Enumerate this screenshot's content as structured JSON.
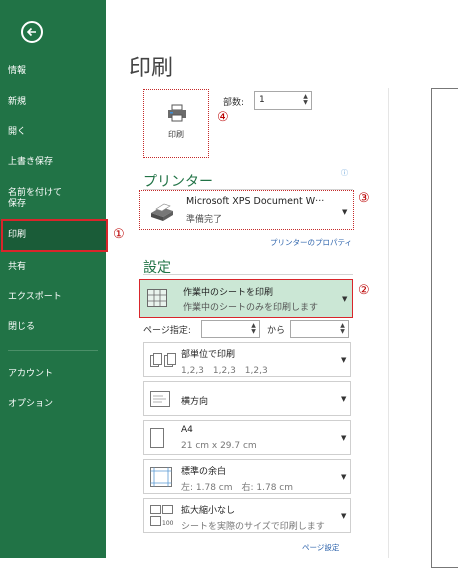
{
  "sidebar": {
    "items": [
      {
        "label": "情報"
      },
      {
        "label": "新規"
      },
      {
        "label": "開く"
      },
      {
        "label": "上書き保存"
      },
      {
        "label": "名前を付けて\n保存"
      },
      {
        "label": "印刷"
      },
      {
        "label": "共有"
      },
      {
        "label": "エクスポート"
      },
      {
        "label": "閉じる"
      },
      {
        "label": "アカウント"
      },
      {
        "label": "オプション"
      }
    ]
  },
  "main": {
    "title": "印刷",
    "print_button_label": "印刷",
    "copies_label": "部数:",
    "copies_value": "1",
    "printer_section": "プリンター",
    "printer_name": "Microsoft XPS Document W···",
    "printer_status": "準備完了",
    "printer_properties_link": "プリンターのプロパティ",
    "settings_section": "設定",
    "print_what": {
      "title": "作業中のシートを印刷",
      "sub": "作業中のシートのみを印刷します"
    },
    "pages_label": "ページ指定:",
    "pages_to": "から",
    "collate": {
      "title": "部単位で印刷",
      "sub": "1,2,3　1,2,3　1,2,3"
    },
    "orientation": {
      "title": "横方向"
    },
    "paper": {
      "title": "A4",
      "sub": "21 cm x 29.7 cm"
    },
    "margins": {
      "title": "標準の余白",
      "sub": "左: 1.78 cm　右: 1.78 cm"
    },
    "scaling": {
      "title": "拡大縮小なし",
      "sub": "シートを実際のサイズで印刷します"
    },
    "page_setup_link": "ページ設定"
  },
  "callouts": [
    "①",
    "②",
    "③",
    "④"
  ],
  "colors": {
    "sidebar": "#217346",
    "highlight": "#d9252b",
    "selected": "#cbe7d5",
    "link": "#2e64ac"
  },
  "icons": [
    "back-arrow-icon",
    "printer-icon",
    "info-icon",
    "sheet-grid-icon",
    "collate-icon",
    "landscape-icon",
    "paper-icon",
    "margins-icon",
    "scaling-icon"
  ]
}
